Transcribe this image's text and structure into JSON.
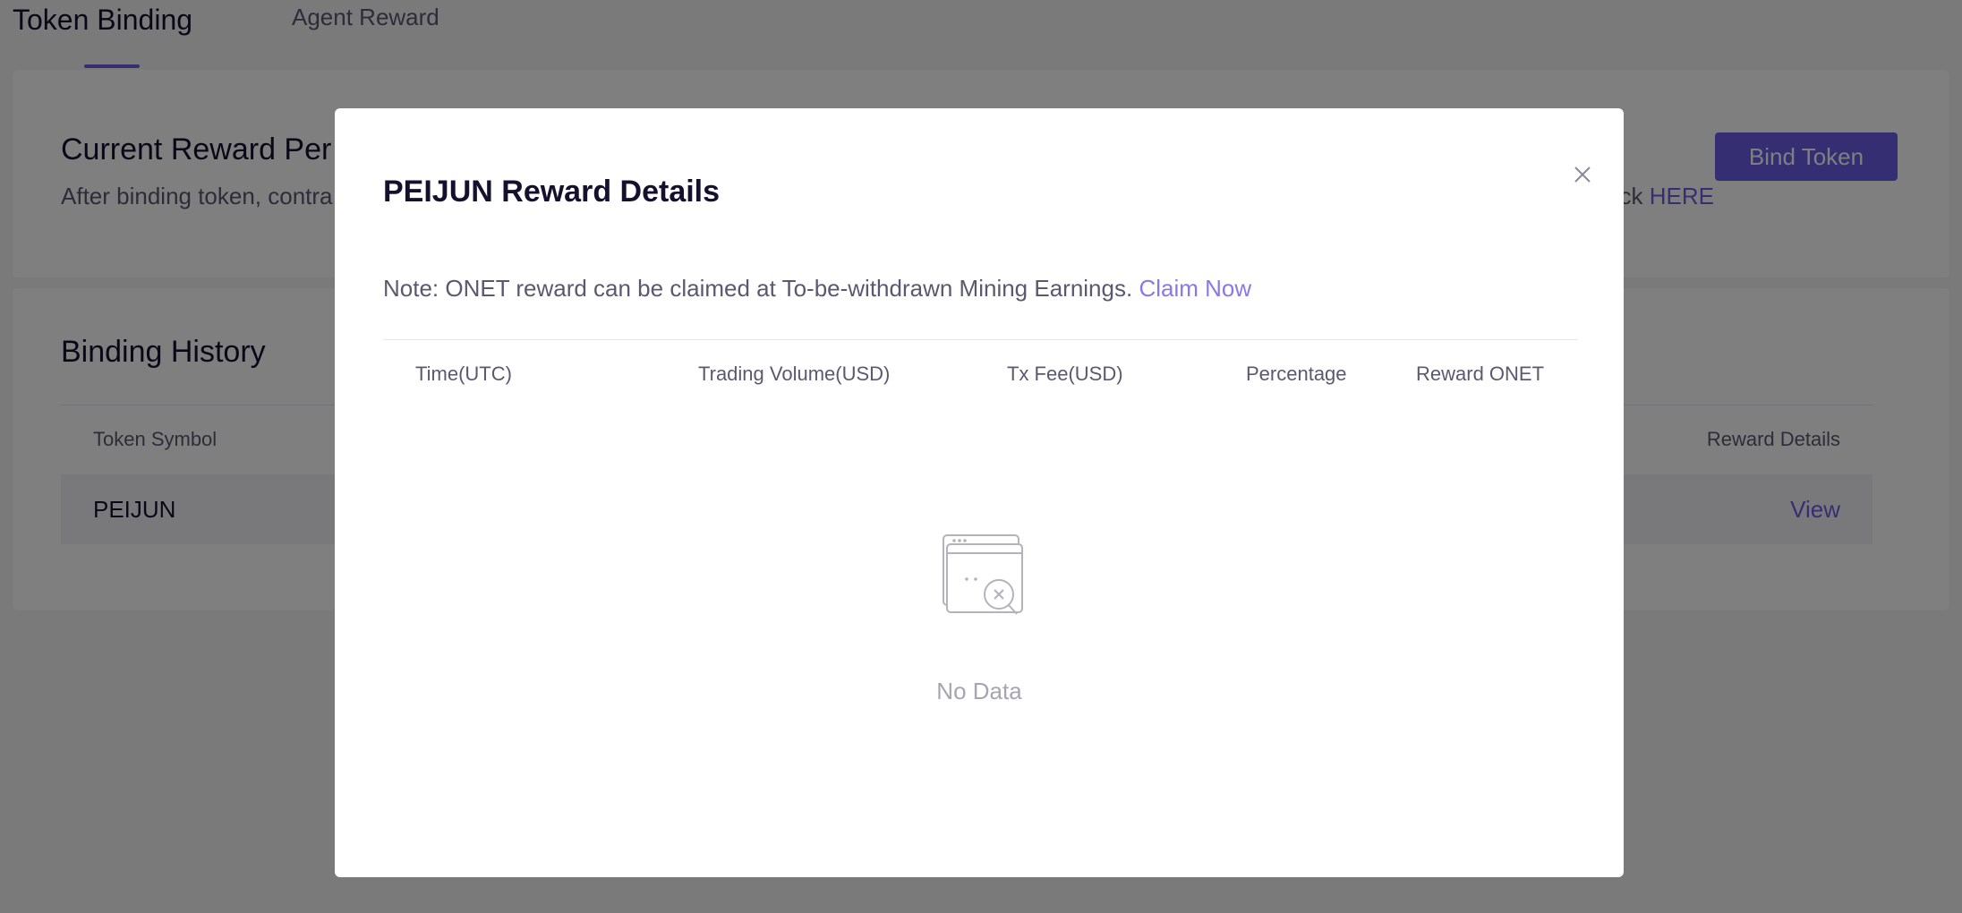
{
  "tabs": {
    "active": "Token Binding",
    "inactive": "Agent Reward"
  },
  "reward_card": {
    "title_visible": "Current Reward Per",
    "description_visible": "After binding token, contra",
    "description_tail": "lick ",
    "here_link": "HERE",
    "bind_button": "Bind Token"
  },
  "history_card": {
    "title": "Binding History",
    "columns": {
      "token_symbol": "Token Symbol",
      "reward_details": "Reward Details"
    },
    "rows": [
      {
        "token_symbol": "PEIJUN",
        "action": "View"
      }
    ]
  },
  "modal": {
    "title": "PEIJUN Reward Details",
    "note": "Note: ONET reward can be claimed at To-be-withdrawn Mining Earnings. ",
    "claim_link": "Claim Now",
    "columns": [
      "Time(UTC)",
      "Trading Volume(USD)",
      "Tx Fee(USD)",
      "Percentage",
      "Reward ONET"
    ],
    "empty_text": "No Data",
    "close_icon": "close-icon",
    "empty_icon": "no-data-icon"
  },
  "colors": {
    "accent": "#6c5ce7",
    "link_light": "#8a78ea",
    "text_primary": "#14112e",
    "text_secondary": "#5b5870",
    "text_muted": "#a6a5b2"
  }
}
